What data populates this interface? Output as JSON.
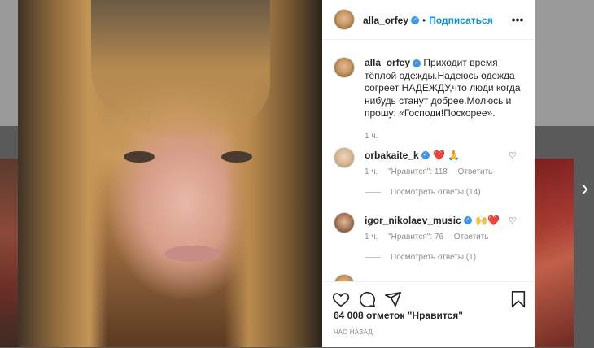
{
  "post": {
    "username": "alla_orfey",
    "follow_label": "Подписаться",
    "caption_username": "alla_orfey",
    "caption_lines": [
      "Приходит время тёплой",
      "одежды.Надеюсь одежда согреет",
      "НАДЕЖДУ,что люди когда нибудь",
      "станут добрее.Молюсь и прошу:",
      "«Господи!Поскорее»."
    ],
    "caption_time": "1 ч.",
    "likes_text": "64 008 отметок \"Нравится\"",
    "time_ago": "ЧАС НАЗАД"
  },
  "comments": [
    {
      "username": "orbakaite_k",
      "emoji": "❤️ 🙏",
      "time": "1 ч.",
      "likes": "\"Нравится\": 118",
      "reply": "Ответить",
      "view_replies": "Посмотреть ответы (14)"
    },
    {
      "username": "igor_nikolaev_music",
      "emoji": "🙌❤️",
      "time": "1 ч.",
      "likes": "\"Нравится\": 76",
      "reply": "Ответить",
      "view_replies": "Посмотреть ответы (1)"
    }
  ],
  "icons": {
    "more": "more-options-icon",
    "like": "heart-icon",
    "comment": "comment-icon",
    "share": "paper-plane-icon",
    "save": "bookmark-icon",
    "next": "chevron-right-icon",
    "verified": "verified-badge-icon"
  },
  "colors": {
    "accent": "#0095f6",
    "verified": "#3897f0",
    "emoji_heart": "#ed4956"
  }
}
